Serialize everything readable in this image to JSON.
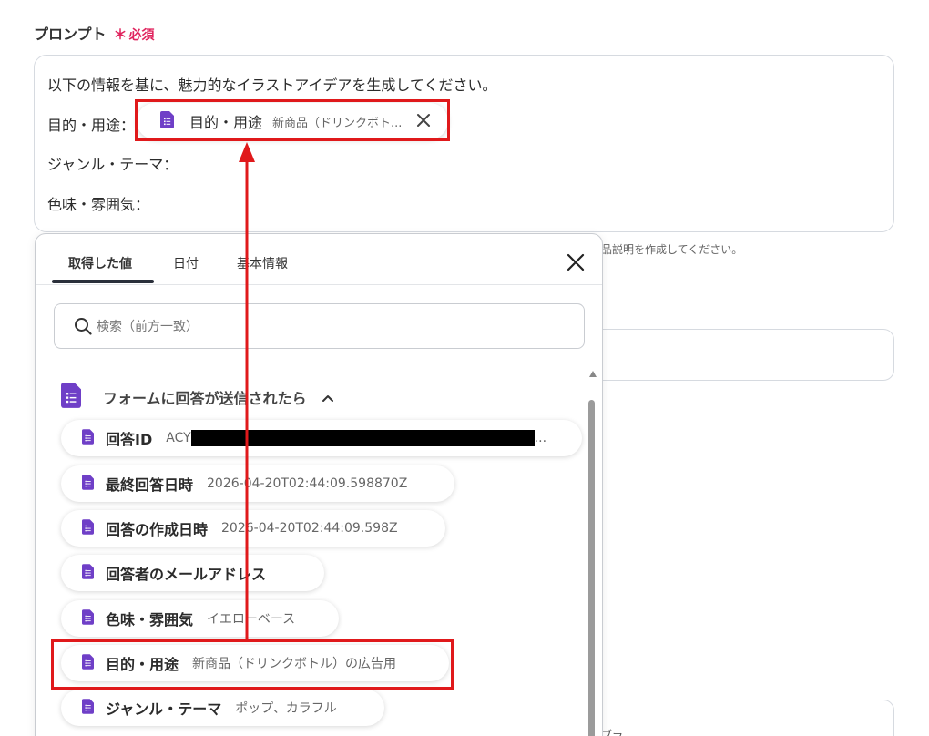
{
  "field": {
    "label": "プロンプト",
    "required_mark": "＊",
    "required_text": "必須"
  },
  "prompt": {
    "line1": "以下の情報を基に、魅力的なイラストアイデアを生成してください。",
    "line2": "目的・用途：",
    "line3": "ジャンル・テーマ：",
    "line4": "色味・雰囲気："
  },
  "inserted_pill": {
    "name": "目的・用途",
    "value": "新商品（ドリンクボト..."
  },
  "background": {
    "hint_fragment": "品説明を作成してください。",
    "bottom_fragment": "ブラ"
  },
  "panel": {
    "tabs": [
      {
        "label": "取得した値"
      },
      {
        "label": "日付"
      },
      {
        "label": "基本情報"
      }
    ],
    "search_placeholder": "検索（前方一致）",
    "group_title": "フォームに回答が送信されたら",
    "items": [
      {
        "name": "回答ID",
        "value": "ACY",
        "suffix": "..."
      },
      {
        "name": "最終回答日時",
        "value": "2026-04-20T02:44:09.598870Z"
      },
      {
        "name": "回答の作成日時",
        "value": "2026-04-20T02:44:09.598Z"
      },
      {
        "name": "回答者のメールアドレス",
        "value": ""
      },
      {
        "name": "色味・雰囲気",
        "value": "イエローベース"
      },
      {
        "name": "目的・用途",
        "value": "新商品（ドリンクボトル）の広告用"
      },
      {
        "name": "ジャンル・テーマ",
        "value": "ポップ、カラフル"
      }
    ]
  },
  "colors": {
    "accent_red": "#e0191b",
    "doc_icon_purple": "#6f3fc7",
    "required_pink": "#e0245e"
  },
  "icons": [
    "doc-icon",
    "close-icon",
    "search-icon",
    "chevron-up-icon"
  ]
}
